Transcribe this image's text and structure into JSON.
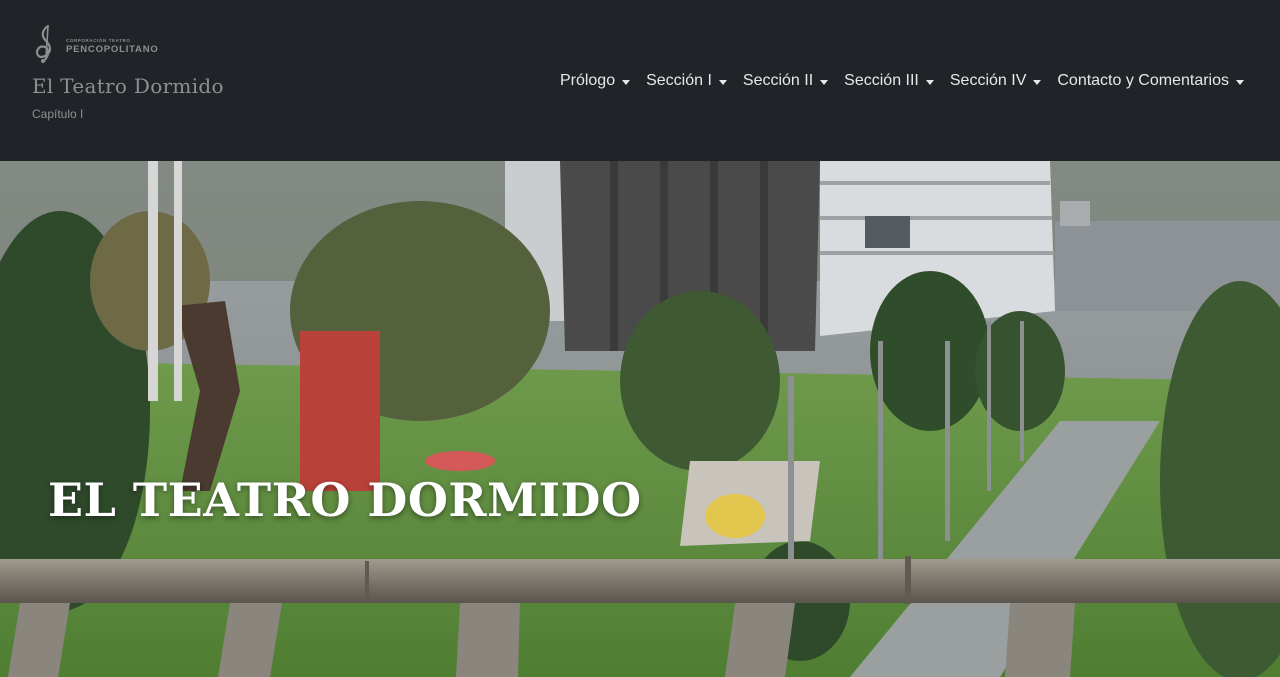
{
  "header": {
    "logo": {
      "small_text": "CORPORACIÓN TEATRO",
      "big_text": "PENCOPOLITANO",
      "icon": "treble-clef-icon"
    },
    "site_title": "El Teatro Dormido",
    "site_subtitle": "Capítulo I"
  },
  "nav": {
    "items": [
      {
        "label": "Prólogo"
      },
      {
        "label": "Sección I"
      },
      {
        "label": "Sección II"
      },
      {
        "label": "Sección III"
      },
      {
        "label": "Sección IV"
      },
      {
        "label": "Contacto y Comentarios"
      }
    ],
    "dropdown_icon": "caret-down-icon"
  },
  "hero": {
    "title": "EL TEATRO DORMIDO"
  },
  "colors": {
    "header_bg": "#202328",
    "nav_text": "#e6e7e8",
    "brand_text": "#8d8f91",
    "hero_title": "#ffffff"
  }
}
